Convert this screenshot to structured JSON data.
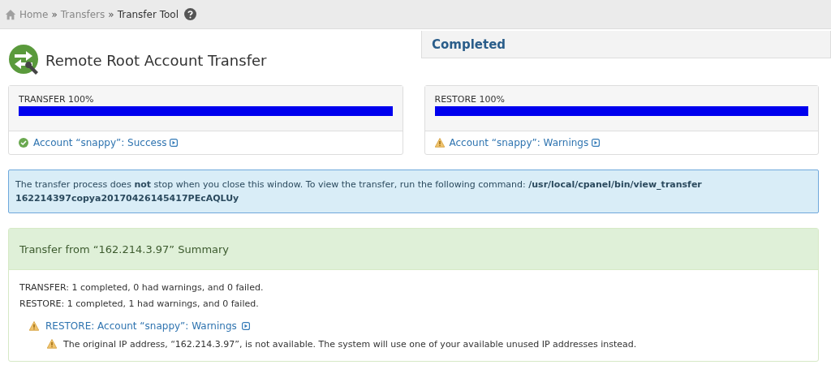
{
  "breadcrumb": [
    {
      "label": "Home",
      "current": false
    },
    {
      "label": "»",
      "current": false
    },
    {
      "label": "Transfers",
      "current": false
    },
    {
      "label": "»",
      "current": false
    },
    {
      "label": "Transfer Tool",
      "current": true
    }
  ],
  "title": "Remote Root Account Transfer",
  "status": "Completed",
  "progress": [
    {
      "label": "TRANSFER 100%",
      "level": 1.0,
      "result": {
        "kind": "success",
        "text": "Account “snappy”: Success"
      }
    },
    {
      "label": "RESTORE 100%",
      "level": 1.0,
      "result": {
        "kind": "warning",
        "text": "Account “snappy”: Warnings"
      }
    }
  ],
  "notice": "The transfer process does **not** stop when you close this window. To view the transfer, run the following command: **/usr/local/cpanel/bin/view_transfer 162214397copya20170426145417PEcAQLUy**",
  "summary": {
    "title": "Transfer from “162.214.3.97” Summary",
    "lines": [
      "TRANSFER: 1 completed, 0 had warnings, and 0 failed.",
      "RESTORE: 1 completed, 1 had warnings, and 0 failed."
    ],
    "issues": [
      {
        "kind": "warning",
        "text": "RESTORE: Account “snappy”: Warnings",
        "messages": [
          {
            "kind": "warning",
            "text": "The original IP address, “162.214.3.97”, is not available. The system will use one of your available unused IP addresses instead."
          }
        ]
      }
    ]
  }
}
